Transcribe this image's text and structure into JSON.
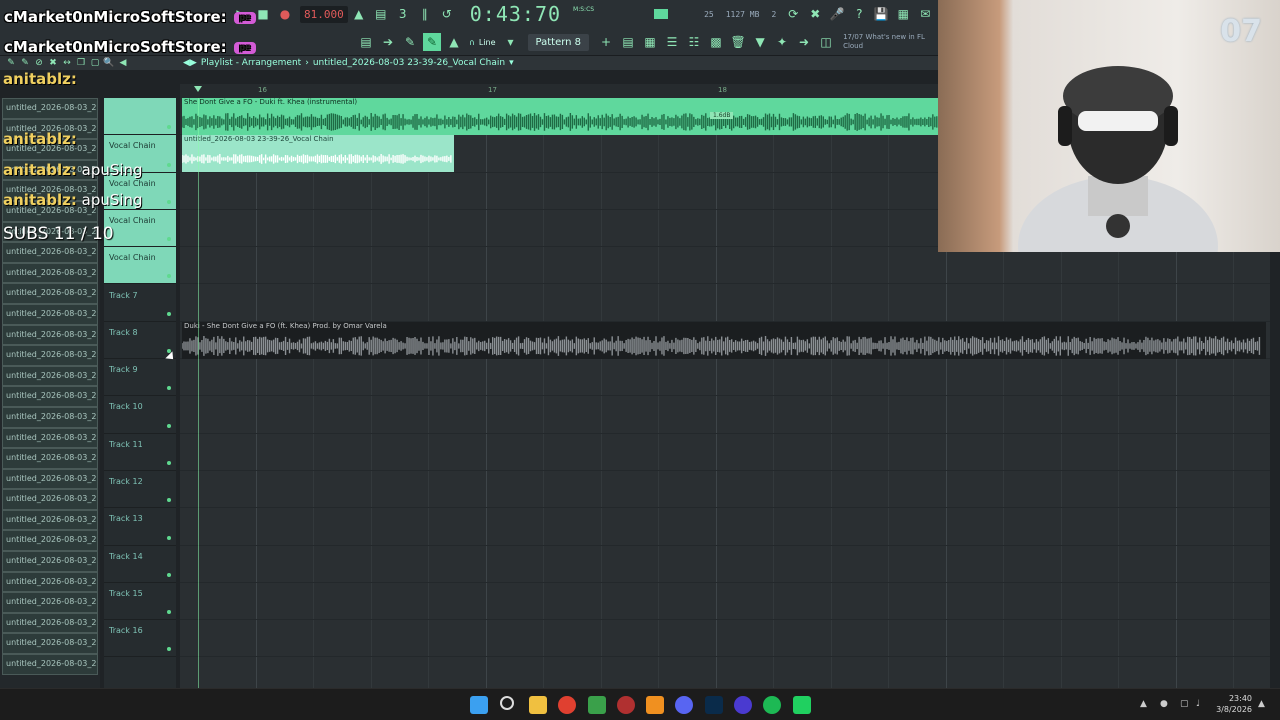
{
  "stream": {
    "top_name_1": "cMarket0nMicroSoftStore:",
    "top_name_2": "cMarket0nMicroSoftStore:",
    "emote_1": "pe",
    "emote_2": "pe",
    "chat": [
      {
        "user": "anitablz:",
        "msg": ""
      },
      {
        "user": "anitablz:",
        "msg": ""
      },
      {
        "user": "anitablz:",
        "msg": "apuSing"
      },
      {
        "user": "anitablz:",
        "msg": "apuSing"
      }
    ],
    "subs": "SUBS 11 / 10",
    "cam_logo": "07"
  },
  "toolbar": {
    "tempo": "81.000",
    "time": "0:43:70",
    "time_unit": "M:S:CS",
    "snap": "Line",
    "pattern": "Pattern 8",
    "cpu": "25",
    "mem_mb": "1127 MB",
    "poly": "2",
    "news_date": "17/07",
    "news_text": "What's new in FL",
    "news_text2": "Cloud"
  },
  "playlist": {
    "title": "Playlist - Arrangement",
    "separator": "›",
    "project": "untitled_2026-08-03 23-39-26_Vocal Chain",
    "ruler": [
      "16",
      "17",
      "18"
    ]
  },
  "browser": {
    "items": [
      "untitled_2026-08-03_23",
      "untitled_2026-08-03_23",
      "untitled_2026-08-03_23",
      "untitled_2026-08-03_23",
      "untitled_2026-08-03_23",
      "untitled_2026-08-03_23",
      "untitled_2026-08-03_23",
      "untitled_2026-08-03_23",
      "untitled_2026-08-03_23",
      "untitled_2026-08-03_23",
      "untitled_2026-08-03_23",
      "untitled_2026-08-03_23",
      "untitled_2026-08-03_23",
      "untitled_2026-08-03_23",
      "untitled_2026-08-03_23",
      "untitled_2026-08-03_23",
      "untitled_2026-08-03_23",
      "untitled_2026-08-03_23",
      "untitled_2026-08-03_23",
      "untitled_2026-08-03_23",
      "untitled_2026-08-03_23",
      "untitled_2026-08-03_23",
      "untitled_2026-08-03_23",
      "untitled_2026-08-03_23",
      "untitled_2026-08-03_23",
      "untitled_2026-08-03_23",
      "untitled_2026-08-03_23",
      "untitled_2026-08-03_23"
    ]
  },
  "tracks": [
    {
      "label": "",
      "vocal": true
    },
    {
      "label": "Vocal Chain",
      "vocal": true
    },
    {
      "label": "Vocal Chain",
      "vocal": true
    },
    {
      "label": "Vocal Chain",
      "vocal": true
    },
    {
      "label": "Vocal Chain",
      "vocal": true
    },
    {
      "label": "Track 7",
      "vocal": false
    },
    {
      "label": "Track 8",
      "vocal": false
    },
    {
      "label": "Track 9",
      "vocal": false
    },
    {
      "label": "Track 10",
      "vocal": false
    },
    {
      "label": "Track 11",
      "vocal": false
    },
    {
      "label": "Track 12",
      "vocal": false
    },
    {
      "label": "Track 13",
      "vocal": false
    },
    {
      "label": "Track 14",
      "vocal": false
    },
    {
      "label": "Track 15",
      "vocal": false
    },
    {
      "label": "Track 16",
      "vocal": false
    }
  ],
  "clips": {
    "instrumental": "She Dont Give a FO - Duki ft. Khea (instrumental)",
    "instrumental_db": "1.6dB",
    "vocal": "untitled_2026-08-03 23-39-26_Vocal Chain",
    "full_song": "Duki - She Dont Give a FO (ft. Khea) Prod. by Omar Varela"
  },
  "taskbar": {
    "clock_time": "23:40",
    "clock_date": "3/8/2026"
  },
  "colors": {
    "accent": "#5fd89d",
    "vocal_clip": "#9be5c9",
    "track_header_vocal": "#7fd8b8"
  }
}
